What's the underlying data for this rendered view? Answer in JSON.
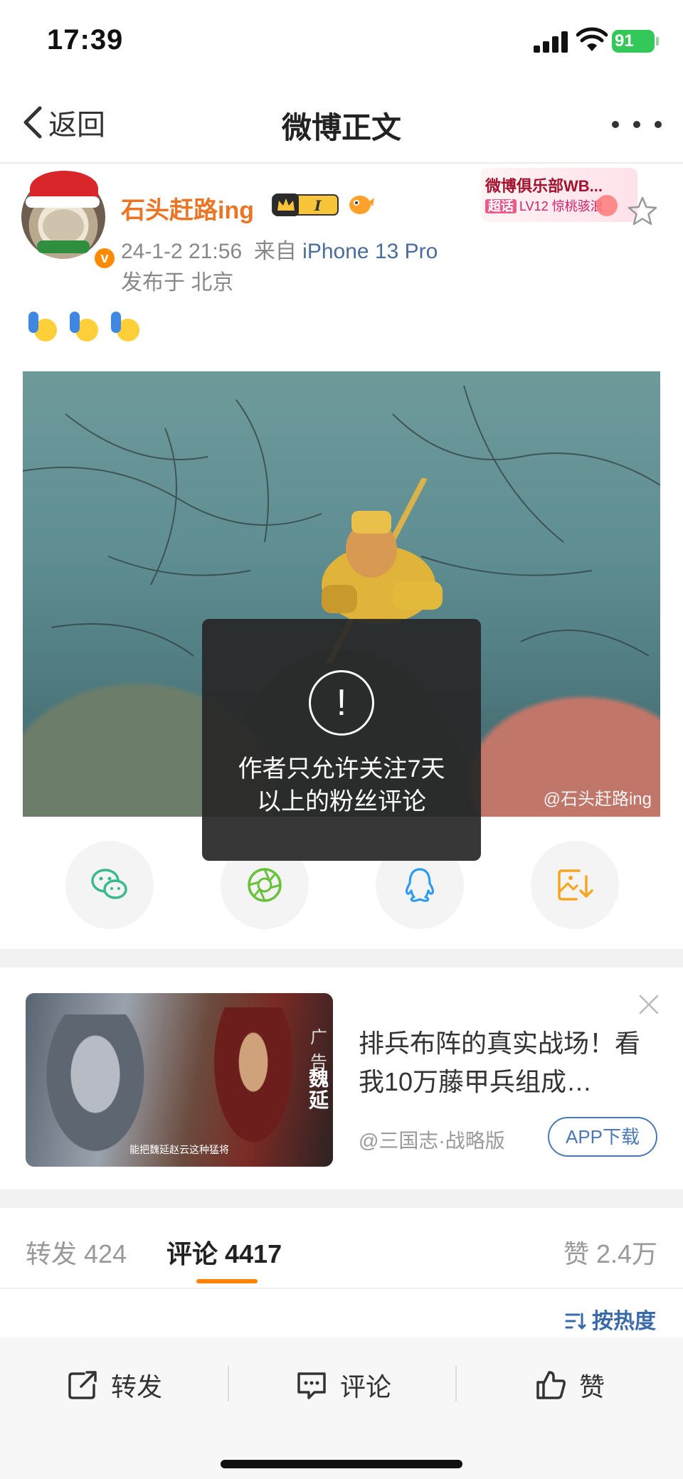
{
  "status_bar": {
    "time": "17:39",
    "battery": "91"
  },
  "nav": {
    "back_label": "返回",
    "title": "微博正文"
  },
  "post": {
    "username": "石头赶路ing",
    "member_level": "I",
    "timestamp": "24-1-2 21:56",
    "source_prefix": "来自",
    "device": "iPhone 13 Pro",
    "location": "发布于 北京",
    "club_title": "微博俱乐部WB...",
    "club_tag_label": "超话",
    "club_tag_text": "LV12 惊桃骇浪",
    "image_watermark": "@石头赶路ing"
  },
  "toast": {
    "message_line1": "作者只允许关注7天",
    "message_line2": "以上的粉丝评论"
  },
  "ad": {
    "tag": "广告",
    "image_caption": "能把魏延赵云这种猛将",
    "image_name": "魏延",
    "title": "排兵布阵的真实战场！看我10万藤甲兵组成…",
    "source": "@三国志·战略版",
    "button": "APP下载"
  },
  "tabs": {
    "repost": "转发 424",
    "comment": "评论 4417",
    "like": "赞 2.4万"
  },
  "sort_label": "按热度",
  "toolbar": {
    "repost": "转发",
    "comment": "评论",
    "like": "赞"
  },
  "colors": {
    "accent": "#ff8200",
    "username": "#eb7425",
    "link": "#4a6d9a"
  },
  "icons": [
    "back-icon",
    "more-icon",
    "star-icon",
    "wechat-icon",
    "moments-icon",
    "qq-icon",
    "save-image-icon",
    "close-icon",
    "share-icon",
    "comment-icon",
    "like-icon",
    "sort-icon"
  ]
}
